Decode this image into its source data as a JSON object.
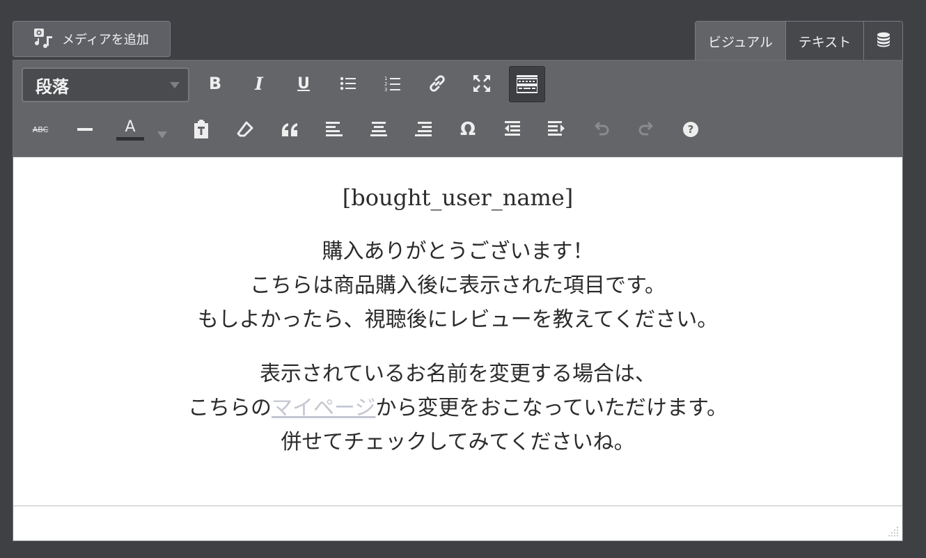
{
  "media_button": {
    "label": "メディアを追加",
    "icon": "add-media-icon"
  },
  "tabs": {
    "visual": "ビジュアル",
    "text": "テキスト",
    "db_icon": "database-icon"
  },
  "toolbar": {
    "format_select": "段落",
    "row1_icons": [
      "bold-icon",
      "italic-icon",
      "underline-icon",
      "bullet-list-icon",
      "numbered-list-icon",
      "link-icon",
      "fullscreen-icon",
      "toolbar-toggle-icon"
    ],
    "row2_icons": [
      "strikethrough-icon",
      "horizontal-line-icon",
      "text-color-icon",
      "paste-text-icon",
      "clear-formatting-icon",
      "blockquote-icon",
      "align-left-icon",
      "align-center-icon",
      "align-right-icon",
      "special-character-icon",
      "outdent-icon",
      "indent-icon",
      "undo-icon",
      "redo-icon",
      "help-icon"
    ],
    "bold": "B",
    "italic": "I",
    "underline": "U",
    "strike": "ABC",
    "text_color": "A",
    "omega": "Ω"
  },
  "content": {
    "shortcode": "[bought_user_name]",
    "p1": [
      "購入ありがとうございます！",
      "こちらは商品購入後に表示された項目です。",
      "もしよかったら、視聴後にレビューを教えてください。"
    ],
    "p2_line1": "表示されているお名前を変更する場合は、",
    "p2_line2_pre": "こちらの",
    "p2_link": "マイページ",
    "p2_line2_post": "から変更をおこなっていただけます。",
    "p2_line3": "併せてチェックしてみてくださいね。"
  },
  "colors": {
    "toolbar": "#646569",
    "background": "#3f4044",
    "link": "#c4c6d0"
  }
}
